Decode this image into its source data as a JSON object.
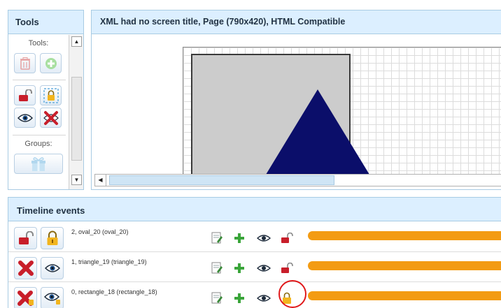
{
  "tools_panel": {
    "title": "Tools",
    "tools_label": "Tools:",
    "groups_label": "Groups:",
    "buttons": [
      {
        "icon": "trash-icon",
        "enabled": false
      },
      {
        "icon": "add-circle-icon",
        "enabled": false
      },
      {
        "icon": "red-lock-open-icon",
        "enabled": true
      },
      {
        "icon": "selection-lock-icon",
        "enabled": true
      },
      {
        "icon": "eye-icon",
        "enabled": true
      },
      {
        "icon": "hide-eye-icon",
        "enabled": true
      },
      {
        "icon": "gift-group-icon",
        "enabled": false
      }
    ]
  },
  "canvas_panel": {
    "title": "XML had no screen title, Page (790x420), HTML Compatible"
  },
  "timeline": {
    "title": "Timeline events",
    "rows": [
      {
        "label": "2, oval_20 (oval_20)",
        "left_icons": [
          "red-lock-open-icon",
          "gold-lock-icon"
        ],
        "lock_state": "red-lock-open-icon"
      },
      {
        "label": "1, triangle_19 (triangle_19)",
        "left_icons": [
          "red-x-icon",
          "eye-icon"
        ],
        "lock_state": "red-lock-open-icon"
      },
      {
        "label": "0, rectangle_18 (rectangle_18)",
        "left_icons": [
          "red-x-badge-icon",
          "eye-badge-icon"
        ],
        "lock_state": "gold-lock-icon"
      }
    ],
    "highlighted_row": 2
  },
  "colors": {
    "panel_header": "#dcefff",
    "panel_border": "#a8cbe3",
    "triangle_fill": "#0b0e6a",
    "rectangle_fill": "#cccccc",
    "timeline_bar": "#f39b13",
    "highlight_ring": "#e0191b"
  }
}
